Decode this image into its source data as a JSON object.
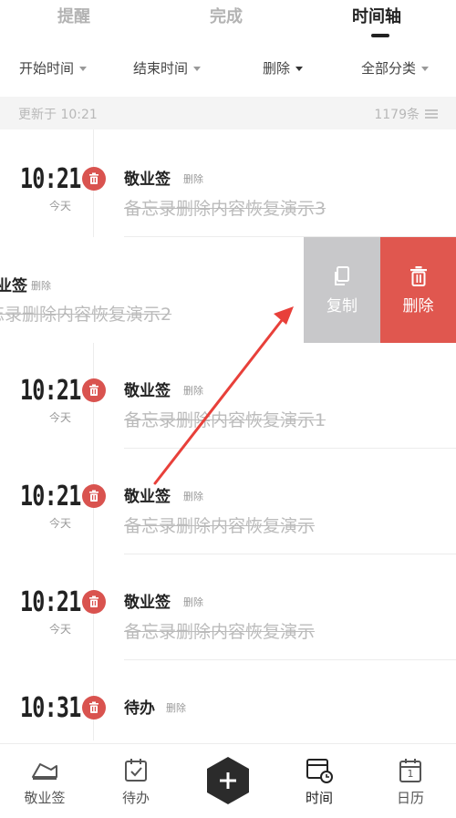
{
  "top_tabs": [
    {
      "label": "提醒"
    },
    {
      "label": "完成"
    },
    {
      "label": "时间轴"
    }
  ],
  "filters": {
    "start_time": "开始时间",
    "end_time": "结束时间",
    "deleted": "删除",
    "category": "全部分类"
  },
  "status": {
    "updated": "更新于 10:21",
    "count": "1179条"
  },
  "rows": [
    {
      "time": "10:21",
      "day": "今天",
      "title": "敬业签",
      "tag": "删除",
      "content": "备忘录删除内容恢复演示3"
    },
    {
      "time": "10:21",
      "day": "今天",
      "title": "敬业签",
      "tag": "删除",
      "content": "备忘录删除内容恢复演示1"
    },
    {
      "time": "10:21",
      "day": "今天",
      "title": "敬业签",
      "tag": "删除",
      "content": "备忘录删除内容恢复演示"
    },
    {
      "time": "10:21",
      "day": "今天",
      "title": "敬业签",
      "tag": "删除",
      "content": "备忘录删除内容恢复演示"
    },
    {
      "time": "10:31",
      "day": "",
      "title": "待办",
      "tag": "删除",
      "content": ""
    }
  ],
  "swiped_row": {
    "title": "业签",
    "tag": "删除",
    "content": "忘录删除内容恢复演示2",
    "copy_label": "复制",
    "delete_label": "删除"
  },
  "bottom_nav": [
    {
      "label": "敬业签",
      "icon": "shoe-icon"
    },
    {
      "label": "待办",
      "icon": "todo-icon"
    },
    {
      "label": "时间",
      "icon": "timeline-icon"
    },
    {
      "label": "日历",
      "icon": "calendar-icon",
      "day": "1"
    }
  ],
  "colors": {
    "accent_red": "#e0574f",
    "badge_red": "#d9534f",
    "copy_gray": "#c8c8ca"
  }
}
